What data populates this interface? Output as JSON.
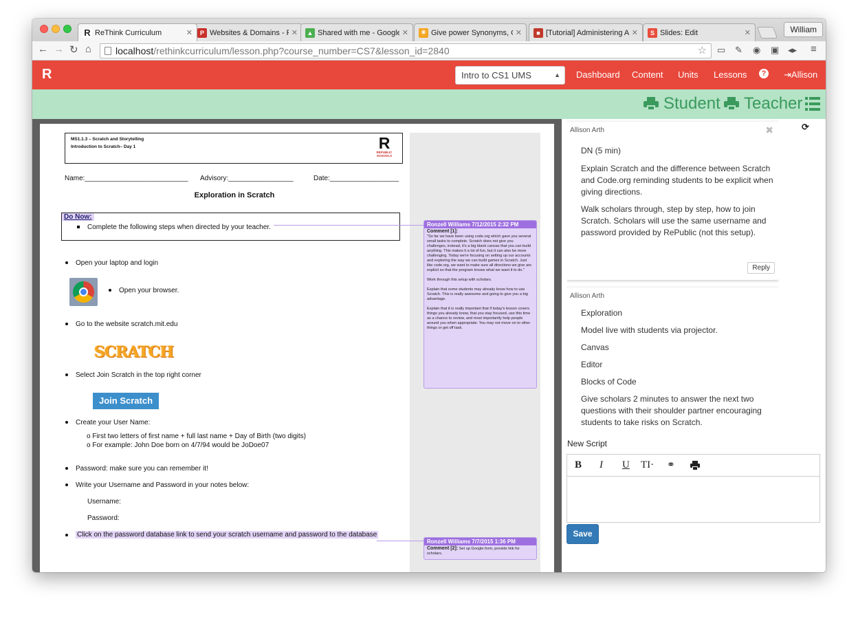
{
  "tabs": [
    {
      "label": "ReThink Curriculum",
      "favicon": "R",
      "color": "#222222"
    },
    {
      "label": "Websites & Domains - Plesk",
      "favicon": "P",
      "color": "#c9302c"
    },
    {
      "label": "Shared with me - Google Drive",
      "favicon": "D",
      "color": "#4caf50"
    },
    {
      "label": "Give power Synonyms, Give",
      "favicon": "T",
      "color": "#f5a623"
    },
    {
      "label": "[Tutorial] Administering Assessments",
      "favicon": "T",
      "color": "#c0392b"
    },
    {
      "label": "Slides: Edit",
      "favicon": "S",
      "color": "#e84c3d"
    }
  ],
  "profile_name": "William",
  "url": {
    "host": "localhost",
    "path": "/rethinkcurriculum/lesson.php?course_number=CS7&lesson_id=2840"
  },
  "app": {
    "logo": "R",
    "course_select": "Intro to CS1 UMS",
    "nav": [
      "Dashboard",
      "Content",
      "Units",
      "Lessons",
      "?",
      "Allison"
    ]
  },
  "modes": {
    "student": "Student",
    "teacher": "Teacher"
  },
  "doc": {
    "header_line1": "MS1.1.3  – Scratch and Storytelling",
    "header_line2": "Introduction to Scratch– Day 1",
    "logo_r": "R",
    "logo_sub": "REPUBLIC SCHOOLS",
    "name_field": "Name:___________________________",
    "advisory_field": "Advisory:_________________",
    "date_field": "Date:__________________",
    "title": "Exploration in Scratch",
    "do_now_label": "Do Now:",
    "do_now_step": "Complete the following steps when directed by your teacher.",
    "step_laptop": "Open your laptop and login",
    "step_browser": "Open your browser.",
    "step_website": "Go to the website scratch.mit.edu",
    "scratch_logo": "SCRATCH",
    "step_join": "Select Join Scratch in the top right corner",
    "join_button": "Join Scratch",
    "step_username": "Create your User Name:",
    "sub1": "o First two letters of first name + full last name + Day of Birth (two digits)",
    "sub2": "o For example: John Doe born on 4/7/94 would be JoDoe07",
    "step_password": "Password: make sure you can remember it!",
    "step_write": "Write your Username and Password in your notes below:",
    "username_label": "Username:",
    "password_label": "Password:",
    "step_link": "Click on the password database link to send your scratch username and password to the database"
  },
  "comments": [
    {
      "head": "Ronzell Williams 7/12/2015 2:32 PM",
      "label": "Comment [1]:",
      "paras": [
        "\"So far we have been using code.org which gave you several small tasks to complete. Scratch does not give you challenges, instead, it's a big blank canvas that you can build anything. This makes it a lot of fun, but it can also be more challenging. Today we're focusing on setting up our accounts and exploring the way we can build games in Scratch. Just like code.org, we want to make sure all directions we give are explicit so that the program knows what we want it to do.\"",
        "Work through this setup with scholars.",
        "Explain that some students may already know how to use Scratch. This is really awesome and going to give you a big advantage.",
        "Explain that it is really important that if today's lesson covers things you already know, that you stay focused, use this time as a chance to review, and most importantly help people around you when appropriate. You may not move on to other things or get off task."
      ]
    },
    {
      "head": "Ronzell Williams 7/7/2015 1:36 PM",
      "label": "Comment [2]:",
      "paras": [
        "Set up Google form, provide link for scholars."
      ]
    }
  ],
  "notes": [
    {
      "author": "Allison Arth",
      "paras": [
        "DN (5 min)",
        "Explain Scratch and the difference between Scratch and Code.org reminding students to be explicit when giving directions.",
        "Walk scholars through, step by step, how to join Scratch. Scholars will use the same username and password provided by RePublic (not this setup)."
      ],
      "reply": "Reply"
    },
    {
      "author": "Allison Arth",
      "paras": [
        "Exploration",
        "Model live with students via projector.",
        "Canvas",
        "Editor",
        "Blocks of Code",
        "Give scholars 2 minutes to answer the next two questions with their shoulder partner encouraging students to take risks on Scratch."
      ]
    }
  ],
  "editor": {
    "label": "New Script",
    "tools": [
      "B",
      "I",
      "U",
      "TI·"
    ],
    "save": "Save"
  }
}
